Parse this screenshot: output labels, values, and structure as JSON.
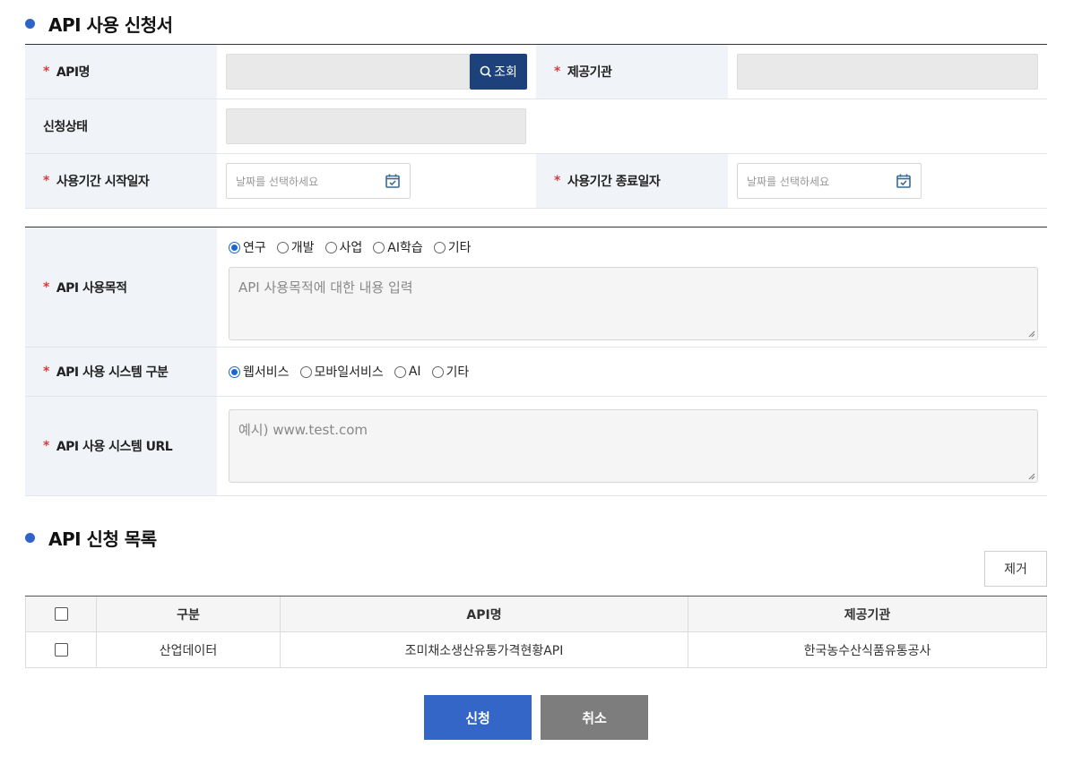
{
  "form": {
    "title": "API 사용 신청서",
    "required_mark": "*",
    "api_name": {
      "label": "API명",
      "value": "",
      "search_button": "조회"
    },
    "provider": {
      "label": "제공기관",
      "value": ""
    },
    "status": {
      "label": "신청상태",
      "value": ""
    },
    "start_date": {
      "label": "사용기간 시작일자",
      "placeholder": "날짜를 선택하세요"
    },
    "end_date": {
      "label": "사용기간 종료일자",
      "placeholder": "날짜를 선택하세요"
    },
    "purpose": {
      "label": "API 사용목적",
      "options": [
        "연구",
        "개발",
        "사업",
        "AI학습",
        "기타"
      ],
      "selected": "연구",
      "placeholder": "API 사용목적에 대한 내용 입력"
    },
    "system_type": {
      "label": "API 사용 시스템 구분",
      "options": [
        "웹서비스",
        "모바일서비스",
        "AI",
        "기타"
      ],
      "selected": "웹서비스"
    },
    "system_url": {
      "label": "API 사용 시스템 URL",
      "placeholder": "예시) www.test.com"
    }
  },
  "list": {
    "title": "API 신청 목록",
    "remove_button": "제거",
    "columns": [
      "구분",
      "API명",
      "제공기관"
    ],
    "rows": [
      {
        "category": "산업데이터",
        "api_name": "조미채소생산유통가격현황API",
        "provider": "한국농수산식품유통공사"
      }
    ]
  },
  "actions": {
    "submit": "신청",
    "cancel": "취소"
  },
  "colors": {
    "accent": "#2f63c9",
    "search_button": "#1d427b",
    "submit": "#3466c8",
    "cancel": "#7d7d7d",
    "required": "#d93a3a"
  }
}
